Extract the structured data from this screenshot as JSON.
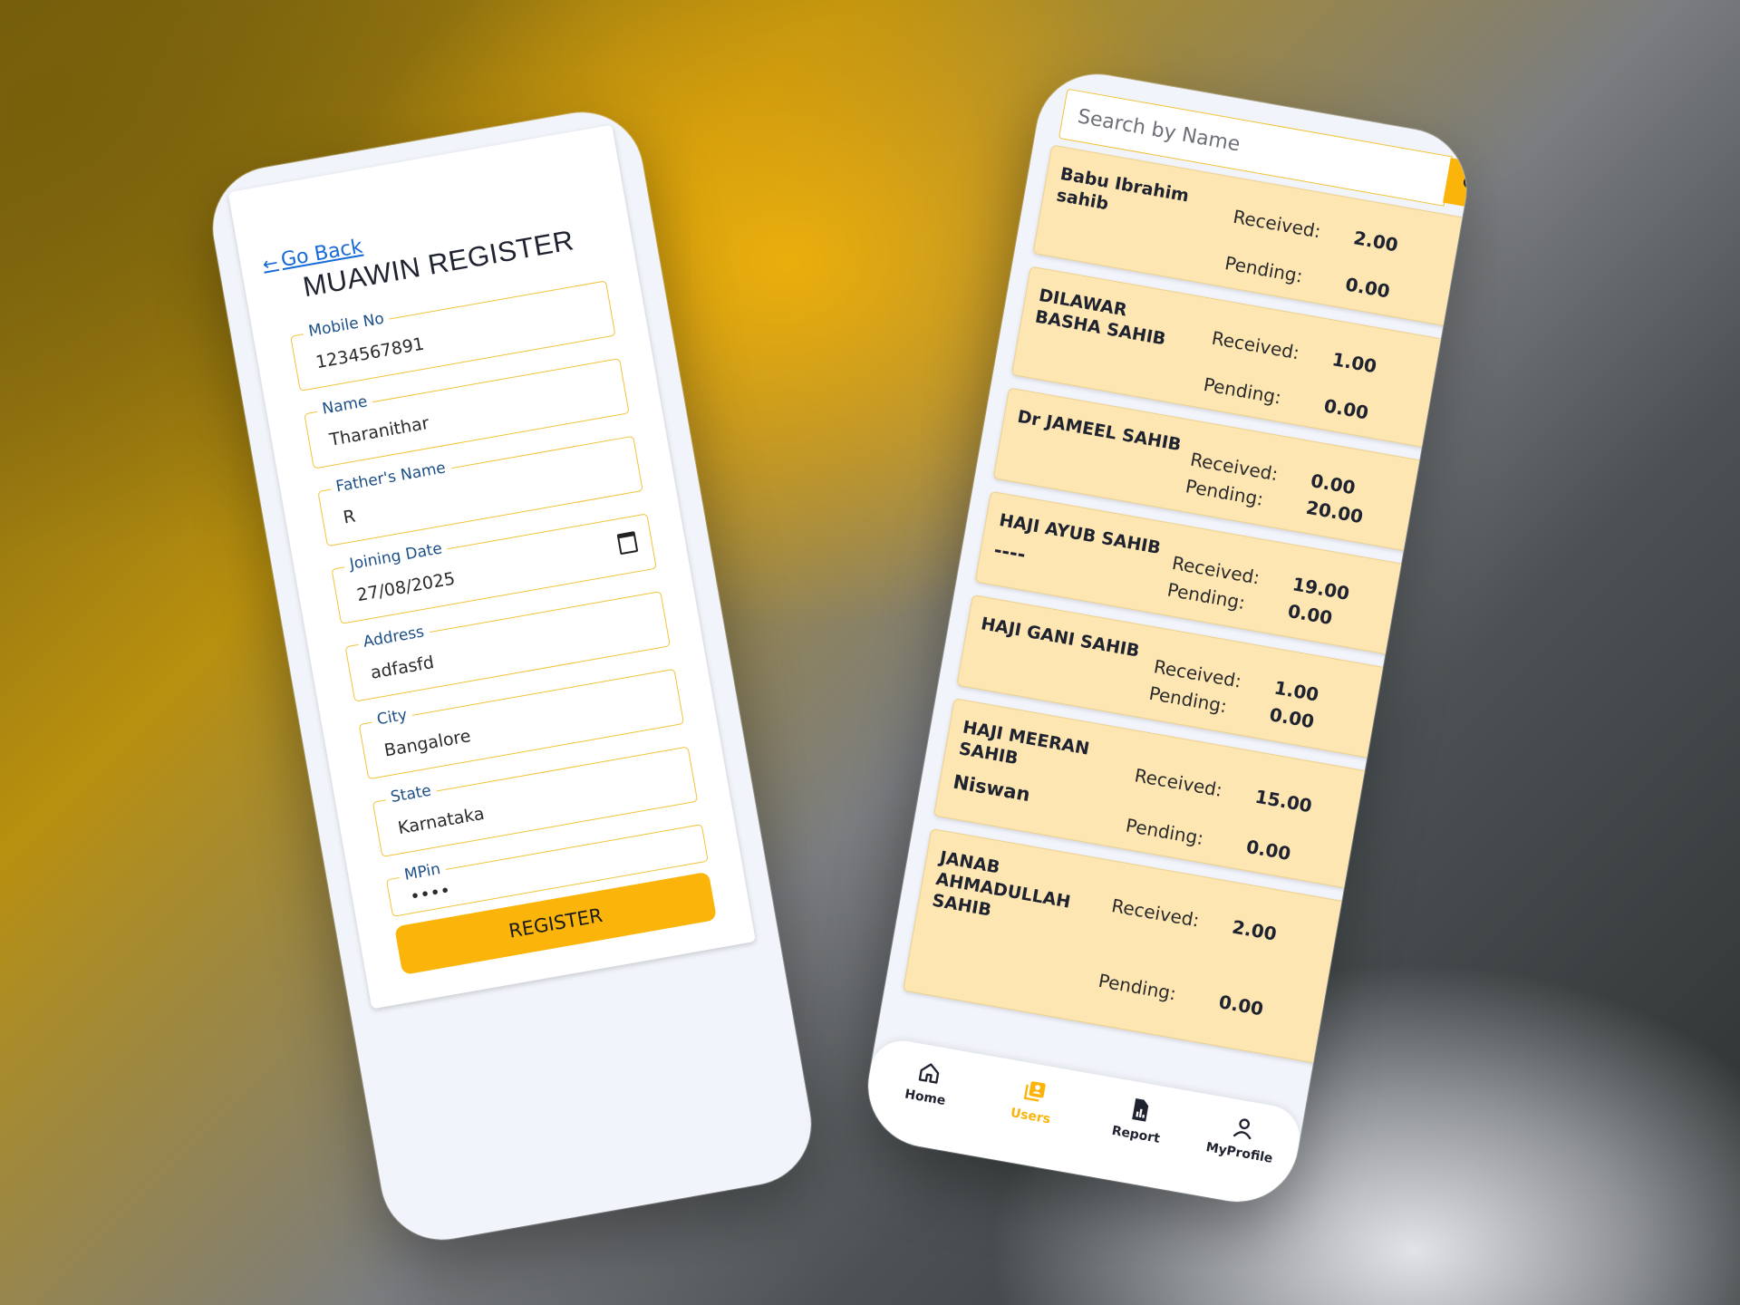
{
  "register": {
    "go_back": "Go Back",
    "title": "MUAWIN REGISTER",
    "fields": [
      {
        "label": "Mobile No",
        "value": "1234567891"
      },
      {
        "label": "Name",
        "value": "Tharanithar"
      },
      {
        "label": "Father's Name",
        "value": "R"
      },
      {
        "label": "Joining Date",
        "value": "27/08/2025"
      },
      {
        "label": "Address",
        "value": "adfasfd"
      },
      {
        "label": "City",
        "value": "Bangalore"
      },
      {
        "label": "State",
        "value": "Karnataka"
      },
      {
        "label": "MPin",
        "value": "••••"
      }
    ],
    "button": "REGISTER"
  },
  "users": {
    "search_placeholder": "Search by Name",
    "received_label": "Received:",
    "pending_label": "Pending:",
    "list": [
      {
        "name": "Babu Ibrahim sahib",
        "sub": "",
        "received": "2.00",
        "pending": "0.00"
      },
      {
        "name": "DILAWAR BASHA SAHIB",
        "sub": "",
        "received": "1.00",
        "pending": "0.00"
      },
      {
        "name": "Dr JAMEEL SAHIB",
        "sub": "",
        "received": "0.00",
        "pending": "20.00"
      },
      {
        "name": "HAJI AYUB SAHIB",
        "sub": "----",
        "received": "19.00",
        "pending": "0.00"
      },
      {
        "name": "HAJI GANI SAHIB",
        "sub": "",
        "received": "1.00",
        "pending": "0.00"
      },
      {
        "name": "HAJI MEERAN SAHIB",
        "sub": "Niswan",
        "received": "15.00",
        "pending": "0.00"
      },
      {
        "name": "JANAB AHMADULLAH SAHIB",
        "sub": "",
        "received": "2.00",
        "pending": "0.00"
      }
    ]
  },
  "nav": {
    "items": [
      {
        "label": "Home",
        "icon": "home-icon"
      },
      {
        "label": "Users",
        "icon": "users-icon"
      },
      {
        "label": "Report",
        "icon": "report-icon"
      },
      {
        "label": "MyProfile",
        "icon": "profile-icon"
      }
    ],
    "active": "Users"
  },
  "colors": {
    "accent": "#fbb50a",
    "field_border": "#f1c33a",
    "card_bg": "#fde6b2",
    "link": "#1769d6",
    "label": "#1c4f86"
  }
}
